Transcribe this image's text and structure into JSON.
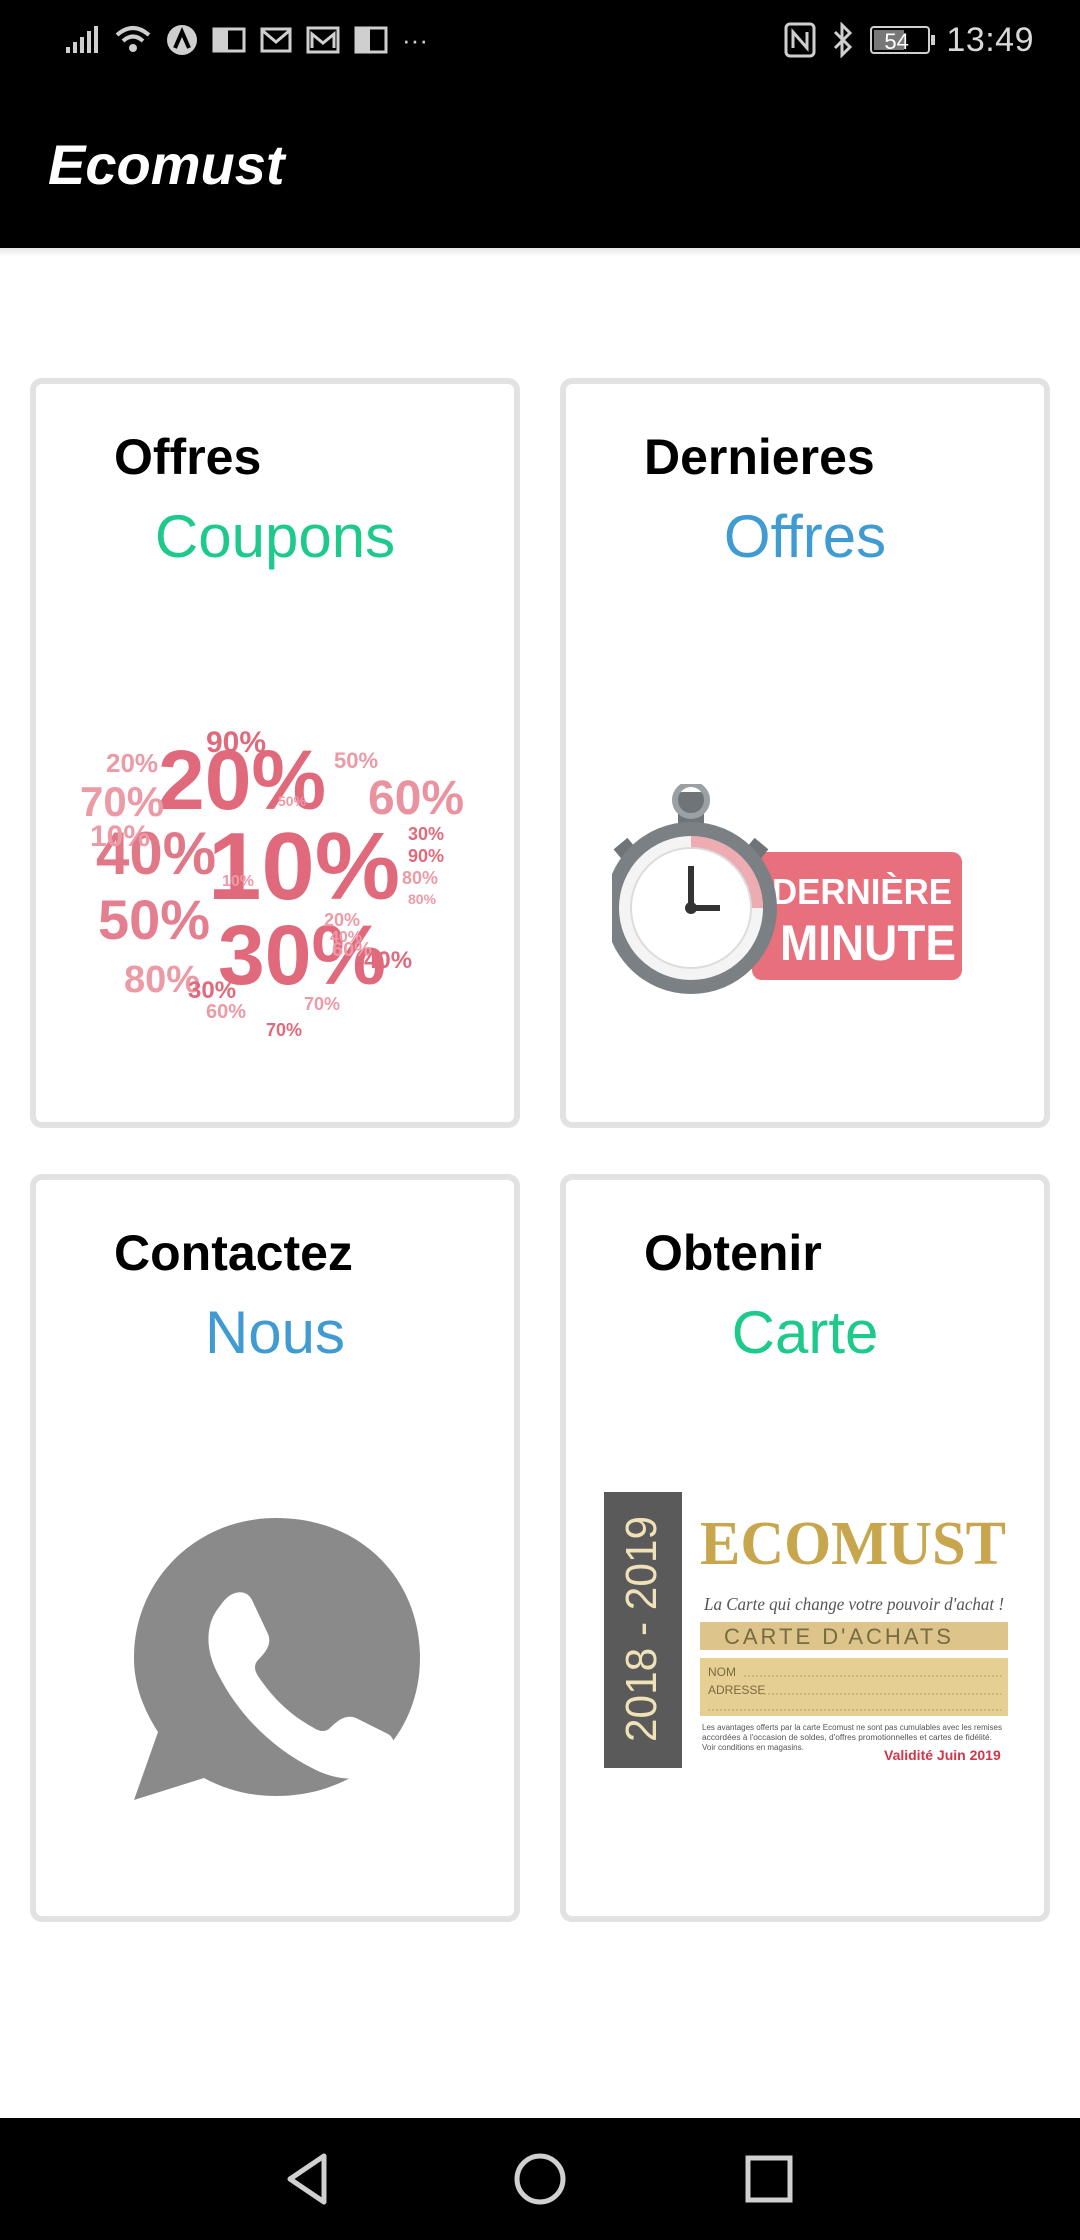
{
  "status_bar": {
    "time": "13:49",
    "battery_level": "54",
    "more_indicator": "···"
  },
  "app_bar": {
    "title": "Ecomust"
  },
  "colors": {
    "accent_green": "#1dc98b",
    "accent_blue": "#3f9bd1",
    "card_border": "#e2e2e2",
    "coupon_red": "#e06a7c",
    "icon_grey": "#8a8a8a"
  },
  "cards": [
    {
      "title": "Offres",
      "subtitle": "Coupons",
      "subtitle_color": "#1dc98b",
      "image": "percentage-coupons-image",
      "image_text": {
        "big": [
          "20%",
          "10%",
          "30%",
          "40%",
          "50%",
          "60%",
          "70%",
          "80%"
        ],
        "small": [
          "90%",
          "20%",
          "70%",
          "10%",
          "50%",
          "60%",
          "30%",
          "90%",
          "80%",
          "40%",
          "70%",
          "60%",
          "80%",
          "30%",
          "20%",
          "10%",
          "50%",
          "40%"
        ]
      }
    },
    {
      "title": "Dernieres",
      "subtitle": "Offres",
      "subtitle_color": "#3f9bd1",
      "image": "last-minute-stopwatch-image",
      "image_text": {
        "line1": "DERNIÈRE",
        "line2": "MINUTE"
      }
    },
    {
      "title": "Contactez",
      "subtitle": "Nous",
      "subtitle_color": "#3f9bd1",
      "image": "whatsapp-icon"
    },
    {
      "title": "Obtenir",
      "subtitle": "Carte",
      "subtitle_color": "#1dc98b",
      "image": "ecomust-card-image",
      "image_text": {
        "years": "2018 - 2019",
        "brand": "ECOMUST",
        "tagline": "La Carte qui change votre pouvoir d'achat !",
        "card_label": "CARTE D'ACHATS",
        "field_name": "NOM",
        "field_address": "ADRESSE",
        "fine_print_1": "Les avantages offerts par la carte Ecomust ne sont pas cumulables avec les remises",
        "fine_print_2": "accordées à l'occasion de soldes, d'offres promotionnelles et cartes de fidélité.",
        "fine_print_3": "Voir conditions en magasins.",
        "validity": "Validité Juin 2019"
      }
    }
  ],
  "nav_bar": {
    "buttons": [
      "back",
      "home",
      "recents"
    ]
  }
}
